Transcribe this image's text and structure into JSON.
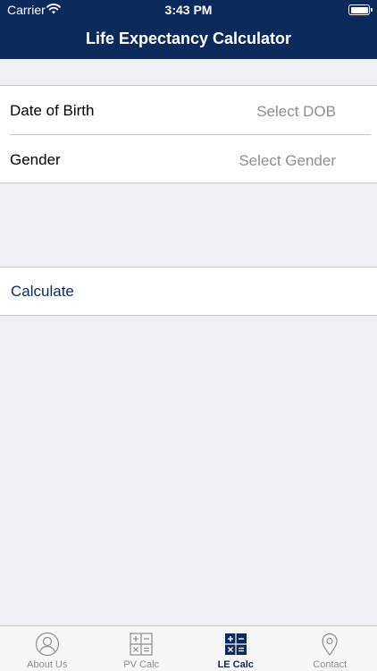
{
  "status": {
    "carrier": "Carrier",
    "time": "3:43 PM"
  },
  "nav": {
    "title": "Life Expectancy Calculator"
  },
  "form": {
    "dob": {
      "label": "Date of Birth",
      "value": "Select DOB"
    },
    "gender": {
      "label": "Gender",
      "value": "Select Gender"
    }
  },
  "action": {
    "calculate_label": "Calculate"
  },
  "tabs": [
    {
      "label": "About Us",
      "icon": "person-circle-icon",
      "active": false
    },
    {
      "label": "PV Calc",
      "icon": "calculator-icon",
      "active": false
    },
    {
      "label": "LE Calc",
      "icon": "calculator-icon",
      "active": true
    },
    {
      "label": "Contact",
      "icon": "map-pin-icon",
      "active": false
    }
  ],
  "colors": {
    "brand": "#0a2a5c",
    "background": "#efeff4",
    "inactive": "#8e8e93"
  }
}
